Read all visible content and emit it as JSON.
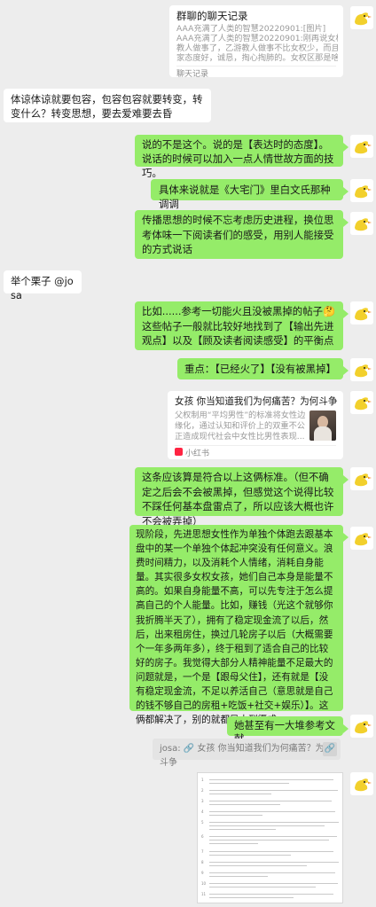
{
  "messages": {
    "chat_record": {
      "title": "群聊的聊天记录",
      "lines": [
        "AAA充满了人类的智慧20220901:[图片]",
        "AAA充满了人类的智慧20220901:刚再说女权",
        "教人做事了，乙游教人做事不比女权少，而且人",
        "家态度好，诚恳，掏心掏肺的。女权区那是啥..."
      ],
      "footer": "聊天记录"
    },
    "m1": "体谅体谅就要包容，包容包容就要转变，转变什么？转变思想，要去爱难要去昏",
    "m2": "说的不是这个。说的是【表达时的态度】。说话的时候可以加入一点人情世故方面的技巧。",
    "m3": "具体来说就是《大宅门》里白文氏那种调调",
    "m4": "传播思想的时候不忘考虑历史进程，换位思考体味一下阅读者们的感受，用别人能接受的方式说话",
    "m5": "举个栗子 @josa",
    "m6": "比如......参考一切能火且没被黑掉的帖子🤔这些帖子一般就比较好地找到了【输出先进观点】以及【顾及读者阅读感受】的平衡点",
    "m7": "重点：【已经火了】【没有被黑掉】",
    "xhs_card": {
      "title": "女孩 你当知道我们为何痛苦？为何斗争",
      "desc_lines": [
        "父权制用“平均男性”的标准将女性边",
        "缘化，通过认知和评价上的双重不公",
        "正造成现代社会中女性比男性表现..."
      ],
      "footer": "小红书"
    },
    "m8": "这条应该算是符合以上这俩标准。（但不确定之后会不会被黑掉，但感觉这个说得比较不踩任何基本盘雷点了，所以应该大概也许不会被弄掉）",
    "m9": "现阶段，先进思想女性作为单独个体跑去跟基本盘中的某一个单独个体起冲突没有任何意义。浪费时间精力，以及消耗个人情绪，消耗自身能量。其实很多女权女孩，她们自己本身是能量不高的。如果自身能量不高，可以先专注于怎么提高自己的个人能量。比如，赚钱（光这个就够你我折腾半天了），拥有了稳定现金流了以后，然后，出来租房住，换过几轮房子以后（大概需要个一年多两年多），终于租到了适合自己的比较好的房子。我觉得大部分人精神能量不足最大的问题就是，一个是【跟母父住】，还有就是【没有稳定现金流，不足以养活自己（意思就是自己的钱不够自己的房租+吃饭+社交+娱乐）】。这俩都解决了，别的就都是水到渠成",
    "m10": "她甚至有一大堆参考文献",
    "quote": "josa: 🔗 女孩 你当知道我们为何痛苦？为何斗争"
  },
  "avatar_icon": "cartoon-duck-avatar",
  "colors": {
    "background": "#ededed",
    "sent_bubble": "#95ec69",
    "received_bubble": "#ffffff"
  }
}
